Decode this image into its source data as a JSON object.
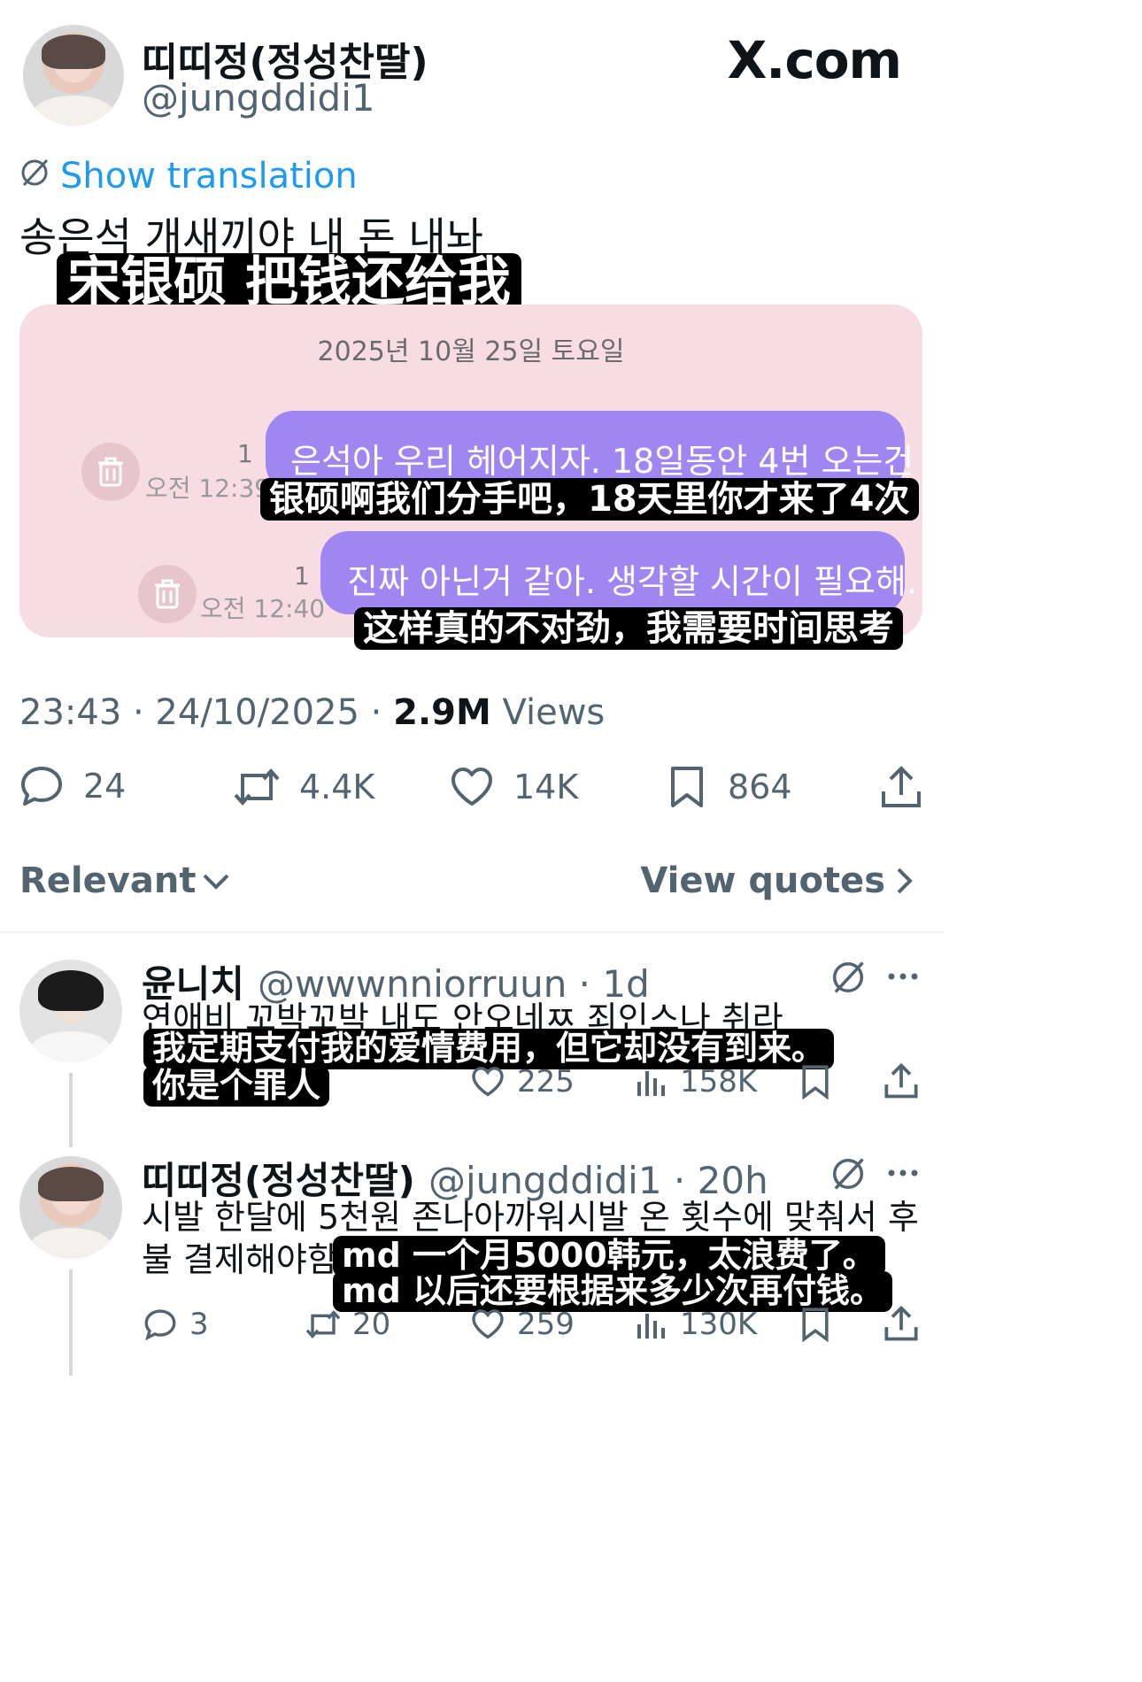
{
  "header": {
    "display_name": "띠띠정(정성찬딸)",
    "handle": "@jungddidi1",
    "brand": "X.com"
  },
  "tweet": {
    "translate_label": "Show translation",
    "text": "송은석 개새끼야 내 돈 내놔",
    "caption": "宋银硕 把钱还给我",
    "timestamp": "23:43 · 24/10/2025 · ",
    "views_count": "2.9M",
    "views_label": " Views"
  },
  "chat": {
    "date": "2025년 10월 25일 토요일",
    "messages": [
      {
        "read_count": "1",
        "time": "오전 12:39",
        "text": "은석아 우리 헤어지자. 18일동안 4번 오는건",
        "caption": "银硕啊我们分手吧，18天里你才来了4次"
      },
      {
        "read_count": "1",
        "time": "오전 12:40",
        "text": "진짜 아닌거 같아. 생각할 시간이 필요해.",
        "caption": "这样真的不对劲，我需要时间思考"
      }
    ]
  },
  "actions": {
    "replies": "24",
    "reposts": "4.4K",
    "likes": "14K",
    "bookmarks": "864"
  },
  "sort": {
    "relevant": "Relevant",
    "view_quotes": "View quotes"
  },
  "replies": [
    {
      "name": "윤니치",
      "handle_time": "@wwwnniorruun · 1d",
      "text": "연애비 꼬박꼬박 내도 안오네ㅉ 죄인스나 취라",
      "caption_line1": "我定期支付我的爱情费用，但它却没有到来。",
      "caption_line2": "你是个罪人",
      "likes": "225",
      "views": "158K"
    },
    {
      "name": "띠띠정(정성찬딸)",
      "handle_time": "@jungddidi1 · 20h",
      "text_line1": "시발 한달에 5천원 존나아까워시발 온 횟수에 맞춰서 후",
      "text_line2": "불 결제해야함",
      "caption_line1": "md 一个月5000韩元，太浪费了。",
      "caption_line2": "md 以后还要根据来多少次再付钱。",
      "replies": "3",
      "reposts": "20",
      "likes": "259",
      "views": "130K"
    }
  ],
  "colors": {
    "link": "#1d9bf0",
    "bubble": "#9f86f0",
    "chat_bg": "#f7dce3",
    "muted": "#536471"
  }
}
